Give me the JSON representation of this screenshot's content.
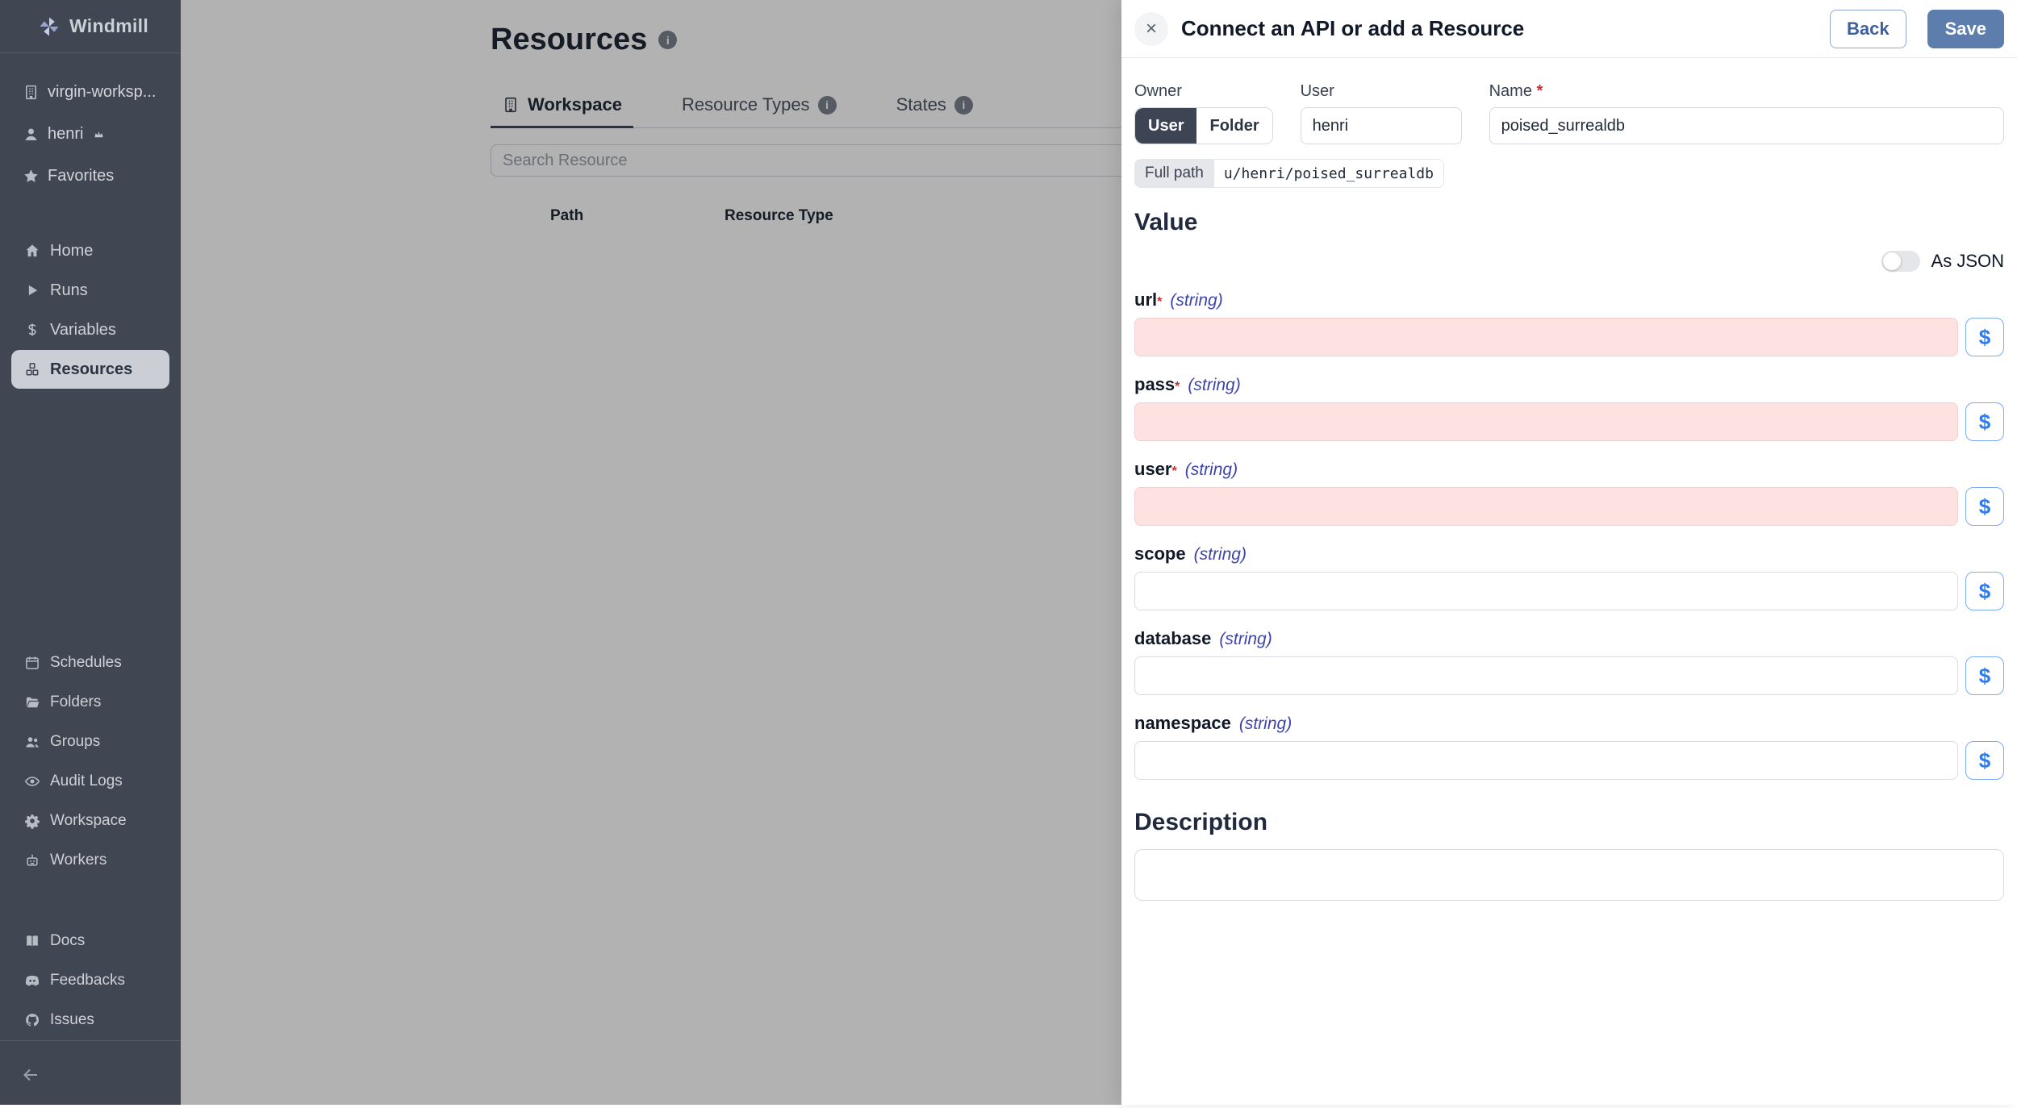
{
  "sidebar": {
    "brand": "Windmill",
    "top_items": [
      {
        "label": "virgin-worksp...",
        "icon": "building"
      },
      {
        "label": "henri",
        "icon": "user",
        "suffix_icon": "crown"
      },
      {
        "label": "Favorites",
        "icon": "star"
      }
    ],
    "nav_items": [
      {
        "label": "Home",
        "icon": "home"
      },
      {
        "label": "Runs",
        "icon": "play"
      },
      {
        "label": "Variables",
        "icon": "dollar"
      },
      {
        "label": "Resources",
        "icon": "cubes",
        "active": true
      }
    ],
    "admin_items": [
      {
        "label": "Schedules",
        "icon": "calendar"
      },
      {
        "label": "Folders",
        "icon": "folder"
      },
      {
        "label": "Groups",
        "icon": "users"
      },
      {
        "label": "Audit Logs",
        "icon": "eye"
      },
      {
        "label": "Workspace",
        "icon": "gear"
      },
      {
        "label": "Workers",
        "icon": "robot"
      }
    ],
    "footer_items": [
      {
        "label": "Docs",
        "icon": "book"
      },
      {
        "label": "Feedbacks",
        "icon": "discord"
      },
      {
        "label": "Issues",
        "icon": "github"
      }
    ]
  },
  "main": {
    "title": "Resources",
    "tabs": [
      {
        "label": "Workspace",
        "icon": "building",
        "active": true
      },
      {
        "label": "Resource Types",
        "info": true
      },
      {
        "label": "States",
        "info": true
      }
    ],
    "search_placeholder": "Search Resource",
    "table_headers": [
      "Path",
      "Resource Type"
    ]
  },
  "drawer": {
    "close_icon": "×",
    "title": "Connect an API or add a Resource",
    "back_label": "Back",
    "save_label": "Save",
    "owner_label": "Owner",
    "owner_options": [
      "User",
      "Folder"
    ],
    "owner_selected": "User",
    "user_label": "User",
    "user_value": "henri",
    "name_label": "Name",
    "name_required": "*",
    "name_value": "poised_surrealdb",
    "full_path_label": "Full path",
    "full_path_value": "u/henri/poised_surrealdb",
    "value_heading": "Value",
    "as_json_label": "As JSON",
    "dollar_button_label": "$",
    "fields": [
      {
        "name": "url",
        "required": "*",
        "type": "(string)",
        "value": "",
        "invalid": true
      },
      {
        "name": "pass",
        "required": "*",
        "type": "(string)",
        "value": "",
        "invalid": true
      },
      {
        "name": "user",
        "required": "*",
        "type": "(string)",
        "value": "",
        "invalid": true
      },
      {
        "name": "scope",
        "required": "",
        "type": "(string)",
        "value": "",
        "invalid": false
      },
      {
        "name": "database",
        "required": "",
        "type": "(string)",
        "value": "",
        "invalid": false
      },
      {
        "name": "namespace",
        "required": "",
        "type": "(string)",
        "value": "",
        "invalid": false
      }
    ],
    "description_heading": "Description",
    "description_value": ""
  },
  "colors": {
    "sidebar_bg": "#414653",
    "accent_save": "#5d7dad",
    "danger": "#cc2f2f",
    "invalid_field_bg": "#fce3e2",
    "type_annotation": "#3e44ad",
    "dollar_blue": "#2e7bee",
    "active_pill": "#cbced4"
  }
}
